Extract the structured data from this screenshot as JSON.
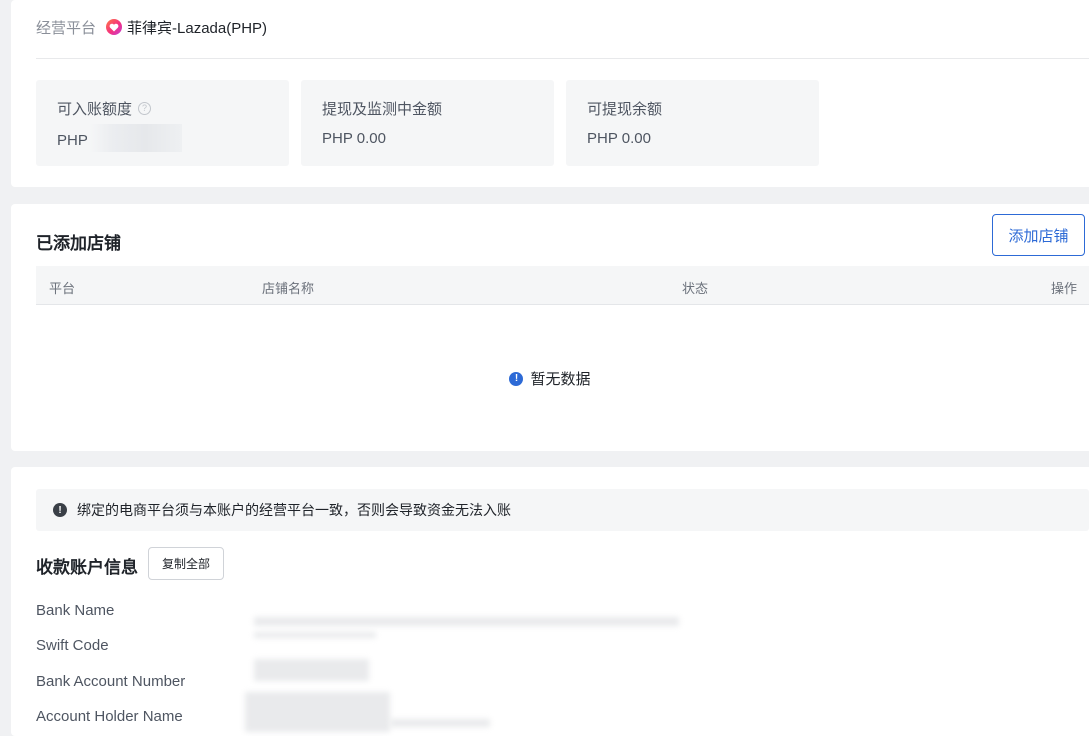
{
  "platform": {
    "label": "经营平台",
    "value": "菲律宾-Lazada(PHP)",
    "icon": "lazada-heart-icon"
  },
  "balances": [
    {
      "label": "可入账额度",
      "value": "PHP",
      "has_help": true
    },
    {
      "label": "提现及监测中金额",
      "value": "PHP 0.00",
      "has_help": false
    },
    {
      "label": "可提现余额",
      "value": "PHP 0.00",
      "has_help": false
    }
  ],
  "stores": {
    "title": "已添加店铺",
    "add_button": "添加店铺",
    "columns": [
      "平台",
      "店铺名称",
      "状态",
      "操作"
    ],
    "empty_text": "暂无数据"
  },
  "account": {
    "notice": "绑定的电商平台须与本账户的经营平台一致，否则会导致资金无法入账",
    "title": "收款账户信息",
    "copy_all": "复制全部",
    "fields": [
      "Bank Name",
      "Swift Code",
      "Bank Account Number",
      "Account Holder Name"
    ]
  },
  "colors": {
    "accent": "#2d6ad6",
    "background": "#f0f1f3",
    "card": "#ffffff"
  }
}
